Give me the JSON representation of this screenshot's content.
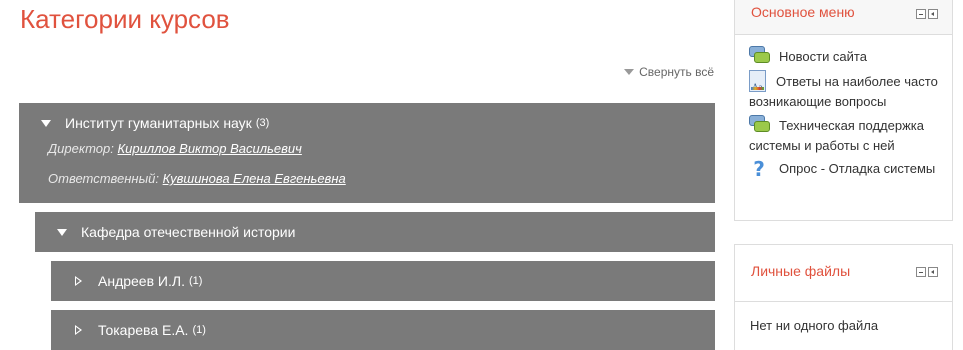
{
  "page": {
    "title": "Категории курсов",
    "collapse_all": "Свернуть всё"
  },
  "categories": [
    {
      "name": "Институт гуманитарных наук",
      "count": "(3)",
      "director_label": "Директор:",
      "director_name": "Кириллов Виктор Васильевич",
      "responsible_label": "Ответственный:",
      "responsible_name": "Кувшинова Елена Евгеньевна"
    },
    {
      "name": "Кафедра отечественной истории"
    },
    {
      "name": "Андреев И.Л.",
      "count": "(1)"
    },
    {
      "name": "Токарева Е.А.",
      "count": "(1)"
    }
  ],
  "main_menu": {
    "title": "Основное меню",
    "items": [
      {
        "label": "Новости сайта",
        "icon": "forum-icon"
      },
      {
        "label": "Ответы на наиболее часто возникающие вопросы",
        "icon": "glossary-icon"
      },
      {
        "label": "Техническая поддержка системы и работы с ней",
        "icon": "forum-icon"
      },
      {
        "label": "Опрос - Отладка системы",
        "icon": "question-icon"
      }
    ]
  },
  "private_files": {
    "title": "Личные файлы",
    "empty_text": "Нет ни одного файла"
  },
  "colors": {
    "accent": "#e0523e",
    "category_bg": "#7a7a7a"
  }
}
